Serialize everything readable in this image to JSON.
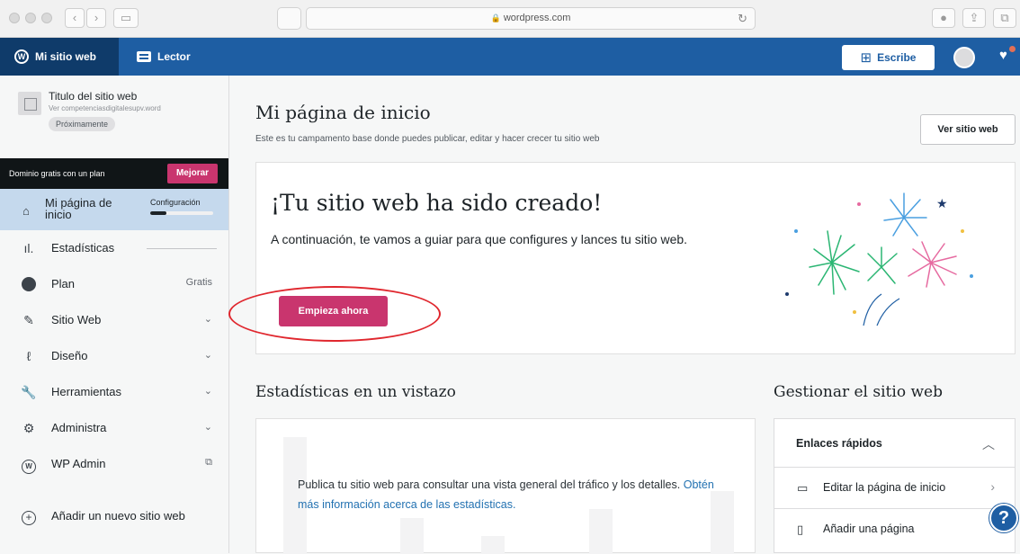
{
  "browser": {
    "url": "wordpress.com"
  },
  "adminbar": {
    "my_site": "Mi sitio web",
    "reader": "Lector",
    "write": "Escribe"
  },
  "sidebar": {
    "site_title": "Titulo del sitio web",
    "site_url": "Ver competenciasdigitalesupv.word",
    "site_badge": "Próximamente",
    "promo_text": "Dominio gratis con un plan",
    "promo_button": "Mejorar",
    "home_label": "Mi página de inicio",
    "home_config": "Configuración",
    "setup_progress": 0.25,
    "items": [
      {
        "label": "Estadísticas",
        "icon": "stats-icon",
        "right": ""
      },
      {
        "label": "Plan",
        "icon": "plan-icon",
        "right": "Gratis"
      },
      {
        "label": "Sitio Web",
        "icon": "pencil-icon",
        "right": "⌄"
      },
      {
        "label": "Diseño",
        "icon": "brush-icon",
        "right": "⌄"
      },
      {
        "label": "Herramientas",
        "icon": "wrench-icon",
        "right": "⌄"
      },
      {
        "label": "Administra",
        "icon": "gear-icon",
        "right": "⌄"
      },
      {
        "label": "WP Admin",
        "icon": "wordpress-icon",
        "right": "⧉"
      }
    ],
    "add_site": "Añadir un nuevo sitio web"
  },
  "main": {
    "title": "Mi página de inicio",
    "subtitle": "Este es tu campamento base donde puedes publicar, editar y hacer crecer tu sitio web",
    "view_site": "Ver sitio web",
    "hero": {
      "title": "¡Tu sitio web ha sido creado!",
      "description": "A continuación, te vamos a guiar para que configures y lances tu sitio web.",
      "button": "Empieza ahora"
    },
    "stats": {
      "heading": "Estadísticas en un vistazo",
      "text": "Publica tu sitio web para consultar una vista general del tráfico y los detalles.",
      "link": "Obtén más información acerca de las estadísticas."
    },
    "manage": {
      "heading": "Gestionar el sitio web",
      "quick_links_title": "Enlaces rápidos",
      "links": [
        {
          "label": "Editar la página de inicio",
          "icon": "laptop-icon"
        },
        {
          "label": "Añadir una página",
          "icon": "page-icon"
        }
      ]
    }
  },
  "colors": {
    "admin_bar": "#1e5ea3",
    "accent_pink": "#c9356e",
    "highlight_red": "#e0272e",
    "home_selected": "#c5d9ed"
  }
}
